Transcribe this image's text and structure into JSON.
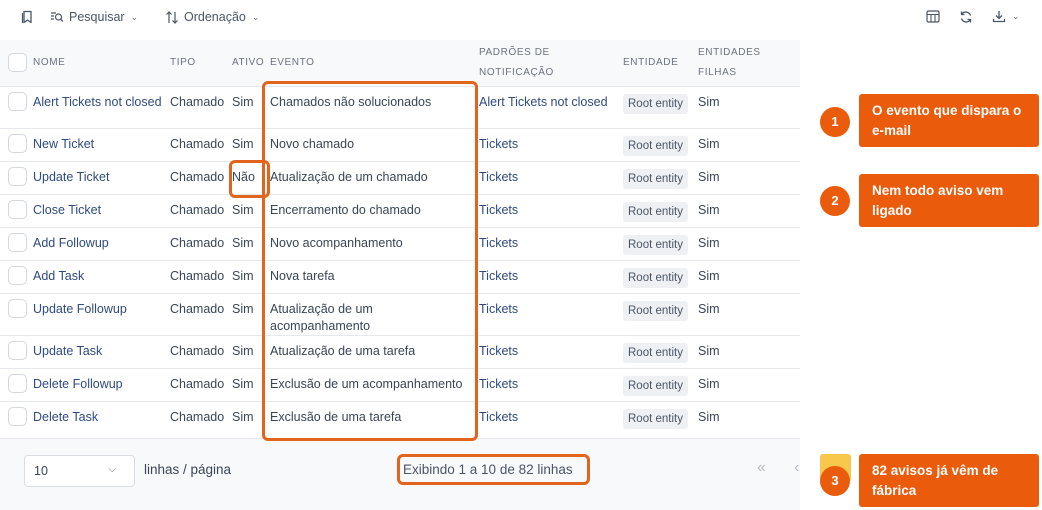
{
  "toolbar": {
    "search_label": "Pesquisar",
    "sort_label": "Ordenação"
  },
  "table": {
    "headers": {
      "name": "NOME",
      "type": "TIPO",
      "active": "ATIVO",
      "event": "EVENTO",
      "templates_1": "PADRÕES DE",
      "templates_2": "NOTIFICAÇÃO",
      "entity": "ENTIDADE",
      "children_1": "ENTIDADES",
      "children_2": "FILHAS"
    },
    "rows": [
      {
        "name": "Alert Tickets not closed",
        "type": "Chamado",
        "active": "Sim",
        "event": "Chamados não solucionados",
        "template": "Alert Tickets not closed",
        "entity": "Root entity",
        "children": "Sim"
      },
      {
        "name": "New Ticket",
        "type": "Chamado",
        "active": "Sim",
        "event": "Novo chamado",
        "template": "Tickets",
        "entity": "Root entity",
        "children": "Sim"
      },
      {
        "name": "Update Ticket",
        "type": "Chamado",
        "active": "Não",
        "event": "Atualização de um chamado",
        "template": "Tickets",
        "entity": "Root entity",
        "children": "Sim"
      },
      {
        "name": "Close Ticket",
        "type": "Chamado",
        "active": "Sim",
        "event": "Encerramento do chamado",
        "template": "Tickets",
        "entity": "Root entity",
        "children": "Sim"
      },
      {
        "name": "Add Followup",
        "type": "Chamado",
        "active": "Sim",
        "event": "Novo acompanhamento",
        "template": "Tickets",
        "entity": "Root entity",
        "children": "Sim"
      },
      {
        "name": "Add Task",
        "type": "Chamado",
        "active": "Sim",
        "event": "Nova tarefa",
        "template": "Tickets",
        "entity": "Root entity",
        "children": "Sim"
      },
      {
        "name": "Update Followup",
        "type": "Chamado",
        "active": "Sim",
        "event": "Atualização de um acompanhamento",
        "template": "Tickets",
        "entity": "Root entity",
        "children": "Sim"
      },
      {
        "name": "Update Task",
        "type": "Chamado",
        "active": "Sim",
        "event": "Atualização de uma tarefa",
        "template": "Tickets",
        "entity": "Root entity",
        "children": "Sim"
      },
      {
        "name": "Delete Followup",
        "type": "Chamado",
        "active": "Sim",
        "event": "Exclusão de um acompanhamento",
        "template": "Tickets",
        "entity": "Root entity",
        "children": "Sim"
      },
      {
        "name": "Delete Task",
        "type": "Chamado",
        "active": "Sim",
        "event": "Exclusão de uma tarefa",
        "template": "Tickets",
        "entity": "Root entity",
        "children": "Sim"
      }
    ]
  },
  "footer": {
    "page_size": "10",
    "per_page_label": "linhas / página",
    "showing": "Exibindo 1 a 10 de 82 linhas",
    "first_icon": "double-chevron-left-icon",
    "prev_icon": "chevron-left-icon"
  },
  "callouts": [
    {
      "number": "1",
      "text": "O evento que dispara o e-mail"
    },
    {
      "number": "2",
      "text": "Nem todo aviso vem ligado"
    },
    {
      "number": "3",
      "text": "82 avisos já vêm de fábrica"
    }
  ],
  "colors": {
    "accent": "#ea5b0c",
    "link": "#2f4a80",
    "header_bg": "#f8f9fb",
    "highlight_yellow": "#f7c84b"
  }
}
